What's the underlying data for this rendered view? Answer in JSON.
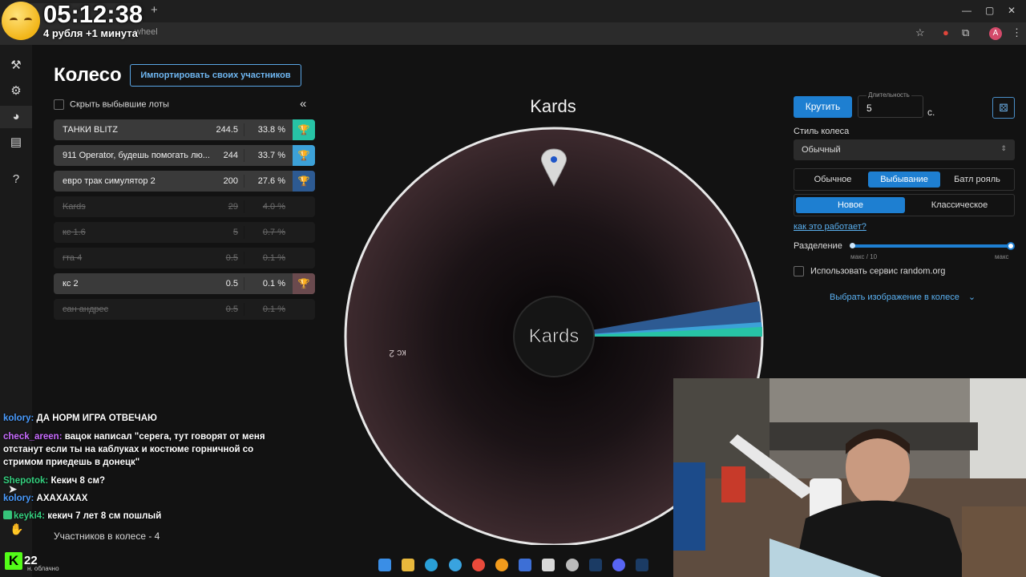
{
  "overlay": {
    "timer": "05:12:38",
    "timer_rule": "4 рубля +1 минута"
  },
  "browser": {
    "url_fragment": "wheel"
  },
  "header": {
    "title": "Колесо",
    "import_button": "Импортировать своих участников"
  },
  "controls": {
    "hide_finished": "Скрыть выбывшие лоты",
    "collapse_icon": "double-chevron-left-icon"
  },
  "lots": [
    {
      "name": "ТАНКИ BLITZ",
      "amount": "244.5",
      "percent": "33.8 %",
      "status": "active",
      "color": "#27c3a5"
    },
    {
      "name": "911 Operator, будешь помогать лю...",
      "amount": "244",
      "percent": "33.7 %",
      "status": "active",
      "color": "#3ca1d8"
    },
    {
      "name": "евро трак симулятор 2",
      "amount": "200",
      "percent": "27.6 %",
      "status": "active",
      "color": "#2d5a92"
    },
    {
      "name": "Kards",
      "amount": "29",
      "percent": "4.0 %",
      "status": "out"
    },
    {
      "name": "кс 1.6",
      "amount": "5",
      "percent": "0.7 %",
      "status": "out"
    },
    {
      "name": "гта 4",
      "amount": "0.5",
      "percent": "0.1 %",
      "status": "out"
    },
    {
      "name": "кс 2",
      "amount": "0.5",
      "percent": "0.1 %",
      "status": "active",
      "color": "#6a4a4e"
    },
    {
      "name": "сан андрес",
      "amount": "0.5",
      "percent": "0.1 %",
      "status": "out"
    }
  ],
  "chat": [
    {
      "nick": "kolory:",
      "nick_color": "#4a9cff",
      "text": "ДА НОРМ ИГРА ОТВЕЧАЮ"
    },
    {
      "nick": "check_areen:",
      "nick_color": "#c86bff",
      "text": "вацок написал \"серега, тут говорят от меня отстанут если ты на каблуках и костюме горничной со стримом приедешь в донецк\""
    },
    {
      "nick": "Shepotok:",
      "nick_color": "#35d07f",
      "text": "Кекич 8 см?"
    },
    {
      "nick": "kolory:",
      "nick_color": "#4a9cff",
      "text": "АХАХАХАХ"
    },
    {
      "nick": "keyki4:",
      "nick_color": "#35d07f",
      "text": "кекич 7 лет 8 см пошлый"
    }
  ],
  "footer": {
    "participants": "Участников в колесе - 4",
    "kick_viewers": "22",
    "weather": "н. облачно"
  },
  "wheel": {
    "pointer_label": "Kards",
    "center_label": "Kards",
    "slice_label": "кс 2",
    "base_color": "#3d2a2e",
    "rim_color": "#e8e8e8"
  },
  "panel": {
    "spin_button": "Крутить",
    "duration_label": "Длительность",
    "duration_value": "5",
    "duration_unit": "с.",
    "style_label": "Стиль колеса",
    "style_value": "Обычный",
    "modes": [
      "Обычное",
      "Выбывание",
      "Батл рояль"
    ],
    "mode_selected": "Выбывание",
    "submodes": [
      "Новое",
      "Классическое"
    ],
    "submode_selected": "Новое",
    "how_link": "как это работает?",
    "split_label": "Разделение",
    "split_min": "макс / 10",
    "split_max": "макс",
    "random_org": "Использовать сервис random.org",
    "choose_image": "Выбрать изображение в колесе"
  }
}
